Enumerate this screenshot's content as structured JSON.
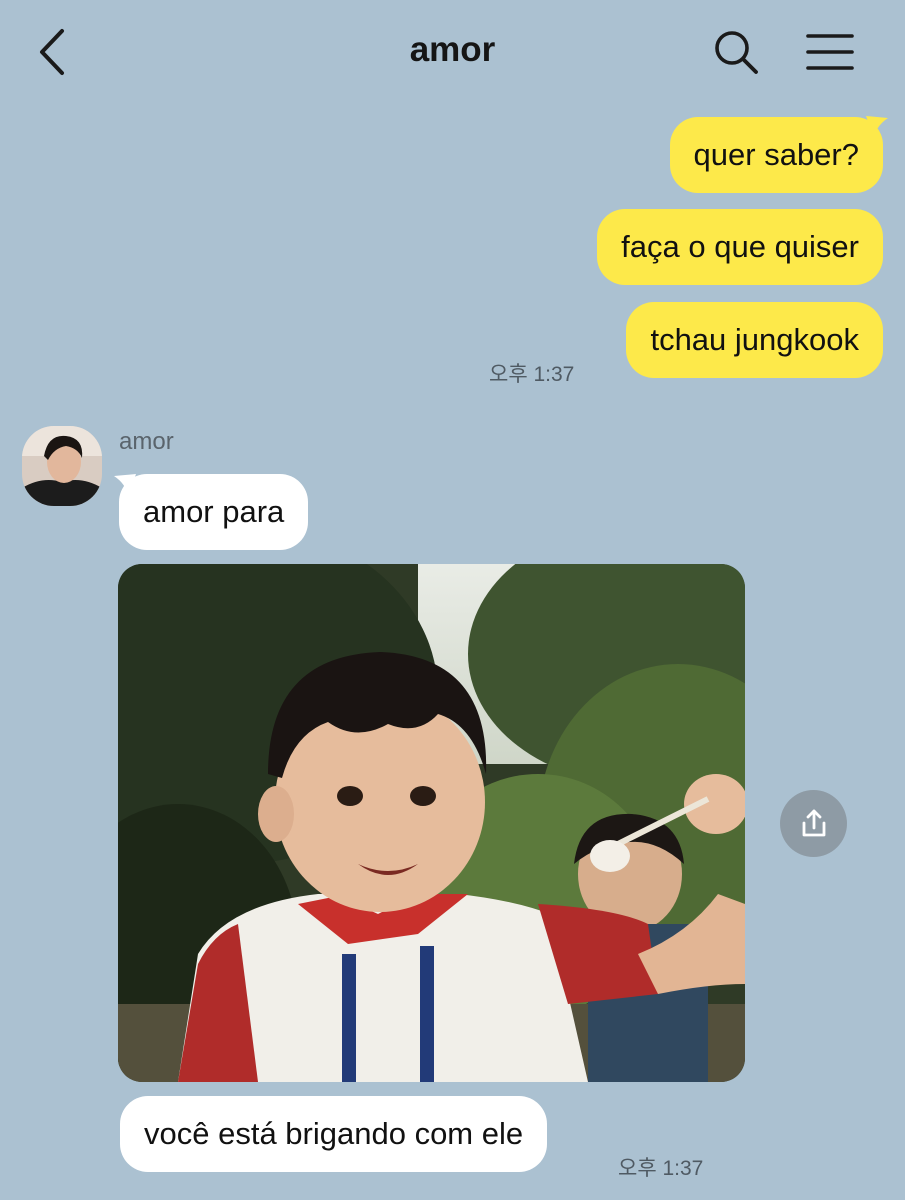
{
  "header": {
    "title": "amor",
    "back_icon": "chevron-left-icon",
    "search_icon": "search-icon",
    "menu_icon": "hamburger-menu-icon"
  },
  "messages_sent": [
    {
      "text": "quer saber?"
    },
    {
      "text": "faça o que quiser"
    },
    {
      "text": "tchau jungkook"
    }
  ],
  "sent_time": "오후 1:37",
  "received": {
    "sender_name": "amor",
    "first_text": "amor para",
    "photo_label": "photo of a smiling child outdoors",
    "last_text": "você está brigando com ele",
    "time": "오후 1:37",
    "share_icon": "share-icon"
  },
  "colors": {
    "background": "#abc1d1",
    "sent_bubble": "#fde94a",
    "received_bubble": "#ffffff"
  }
}
